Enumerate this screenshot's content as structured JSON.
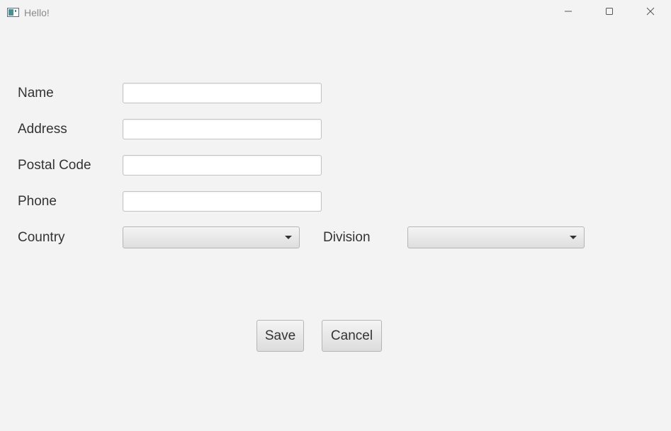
{
  "window": {
    "title": "Hello!",
    "app_icon": "app-window-icon",
    "controls": {
      "minimize_icon": "minimize-icon",
      "maximize_icon": "maximize-icon",
      "close_icon": "close-icon"
    }
  },
  "form": {
    "name": {
      "label": "Name",
      "value": "",
      "placeholder": ""
    },
    "address": {
      "label": "Address",
      "value": "",
      "placeholder": ""
    },
    "postal_code": {
      "label": "Postal Code",
      "value": "",
      "placeholder": ""
    },
    "phone": {
      "label": "Phone",
      "value": "",
      "placeholder": ""
    },
    "country": {
      "label": "Country",
      "selected": ""
    },
    "division": {
      "label": "Division",
      "selected": ""
    }
  },
  "actions": {
    "save_label": "Save",
    "cancel_label": "Cancel"
  },
  "colors": {
    "background": "#f3f3f3",
    "text": "#333333",
    "field_border": "#c2c2c2"
  }
}
